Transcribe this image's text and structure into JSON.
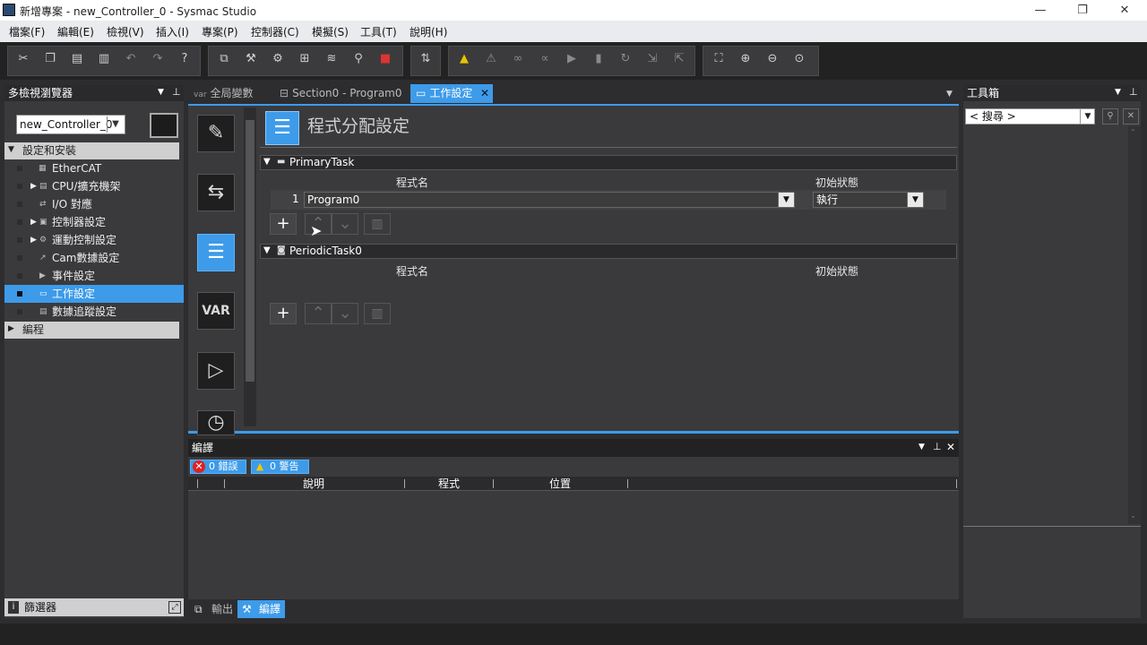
{
  "window": {
    "title": "新增專案 - new_Controller_0 - Sysmac Studio",
    "minimize": "—",
    "restore": "❐",
    "close": "✕"
  },
  "menu": [
    "檔案(F)",
    "編輯(E)",
    "檢視(V)",
    "插入(I)",
    "專案(P)",
    "控制器(C)",
    "模擬(S)",
    "工具(T)",
    "說明(H)"
  ],
  "left_panel": {
    "title": "多檢視瀏覽器",
    "controller": "new_Controller_0",
    "section_setup": "設定和安裝",
    "items": [
      {
        "label": "EtherCAT"
      },
      {
        "label": "CPU/擴充機架"
      },
      {
        "label": "I/O 對應"
      },
      {
        "label": "控制器設定"
      },
      {
        "label": "運動控制設定"
      },
      {
        "label": "Cam數據設定"
      },
      {
        "label": "事件設定"
      },
      {
        "label": "工作設定"
      },
      {
        "label": "數據追蹤設定"
      }
    ],
    "section_program": "編程",
    "filter": "篩選器"
  },
  "tabs": [
    {
      "label": "全局變數"
    },
    {
      "label": "Section0 - Program0"
    },
    {
      "label": "工作設定"
    }
  ],
  "editor": {
    "title": "程式分配設定",
    "var_label": "VAR",
    "tasks": [
      {
        "name": "PrimaryTask",
        "col_program": "程式名",
        "col_state": "初始狀態",
        "rows": [
          {
            "index": "1",
            "program": "Program0",
            "state": "執行"
          }
        ]
      },
      {
        "name": "PeriodicTask0",
        "col_program": "程式名",
        "col_state": "初始狀態",
        "rows": []
      }
    ]
  },
  "compile_panel": {
    "title": "編譯",
    "errors": "0 錯誤",
    "warnings": "0 警告",
    "columns": [
      "說明",
      "程式",
      "位置"
    ]
  },
  "bottom_tabs": [
    {
      "label": "輸出"
    },
    {
      "label": "編譯"
    }
  ],
  "toolbox": {
    "title": "工具箱",
    "search_placeholder": "< 搜尋 >"
  },
  "colors": {
    "accent": "#3d9be9",
    "panel": "#3a3a3d",
    "background": "#2d2d30"
  }
}
